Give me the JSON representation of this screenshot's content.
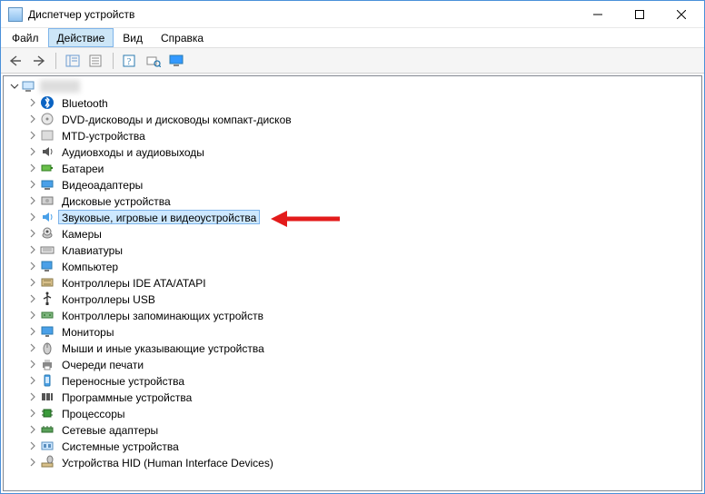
{
  "window": {
    "title": "Диспетчер устройств"
  },
  "menu": {
    "items": [
      "Файл",
      "Действие",
      "Вид",
      "Справка"
    ],
    "active_index": 1
  },
  "tree": {
    "root_label": "",
    "selected_index": 7,
    "categories": [
      {
        "label": "Bluetooth",
        "icon": "bluetooth"
      },
      {
        "label": "DVD-дисководы и дисководы компакт-дисков",
        "icon": "optical"
      },
      {
        "label": "MTD-устройства",
        "icon": "generic"
      },
      {
        "label": "Аудиовходы и аудиовыходы",
        "icon": "audio"
      },
      {
        "label": "Батареи",
        "icon": "battery"
      },
      {
        "label": "Видеоадаптеры",
        "icon": "display-adapter"
      },
      {
        "label": "Дисковые устройства",
        "icon": "disk"
      },
      {
        "label": "Звуковые, игровые и видеоустройства",
        "icon": "sound"
      },
      {
        "label": "Камеры",
        "icon": "camera"
      },
      {
        "label": "Клавиатуры",
        "icon": "keyboard"
      },
      {
        "label": "Компьютер",
        "icon": "computer"
      },
      {
        "label": "Контроллеры IDE ATA/ATAPI",
        "icon": "ide"
      },
      {
        "label": "Контроллеры USB",
        "icon": "usb"
      },
      {
        "label": "Контроллеры запоминающих устройств",
        "icon": "storage-ctrl"
      },
      {
        "label": "Мониторы",
        "icon": "monitor"
      },
      {
        "label": "Мыши и иные указывающие устройства",
        "icon": "mouse"
      },
      {
        "label": "Очереди печати",
        "icon": "printer"
      },
      {
        "label": "Переносные устройства",
        "icon": "portable"
      },
      {
        "label": "Программные устройства",
        "icon": "software"
      },
      {
        "label": "Процессоры",
        "icon": "cpu"
      },
      {
        "label": "Сетевые адаптеры",
        "icon": "network"
      },
      {
        "label": "Системные устройства",
        "icon": "system"
      },
      {
        "label": "Устройства HID (Human Interface Devices)",
        "icon": "hid"
      }
    ]
  }
}
